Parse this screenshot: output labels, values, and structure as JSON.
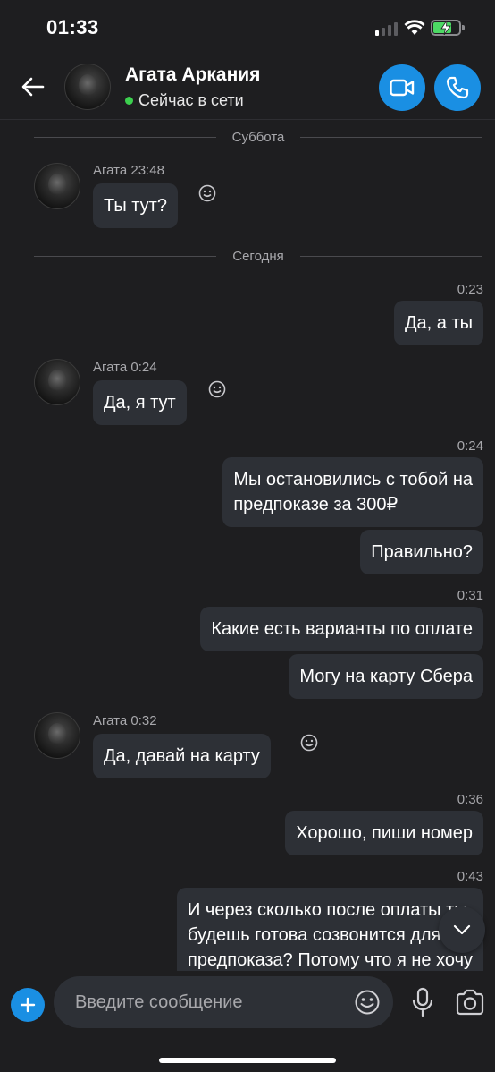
{
  "status_bar": {
    "time": "01:33"
  },
  "header": {
    "contact_name": "Агата Аркания",
    "status": "Сейчас в сети"
  },
  "chat": {
    "dividers": [
      "Суббота",
      "Сегодня"
    ],
    "messages": [
      {
        "sender": "Агата 23:48",
        "text": "Ты тут?"
      },
      {
        "time": "0:23",
        "text": "Да, а ты"
      },
      {
        "sender": "Агата 0:24",
        "text": "Да, я тут"
      },
      {
        "time": "0:24",
        "line1": "Мы остановились с тобой на",
        "line2": "предпоказе за 300₽"
      },
      {
        "text": "Правильно?"
      },
      {
        "time": "0:31",
        "text": "Какие есть варианты по оплате"
      },
      {
        "text": "Могу на карту Сбера"
      },
      {
        "sender": "Агата 0:32",
        "text": "Да, давай на карту"
      },
      {
        "time": "0:36",
        "text": "Хорошо, пиши номер"
      },
      {
        "time": "0:43",
        "line1": "И через сколько после оплаты ты",
        "line2": "будешь готова созвонится для",
        "line3": "предпоказа? Потому что я не хочу"
      }
    ]
  },
  "input": {
    "placeholder": "Введите сообщение"
  },
  "icons": {
    "back": "arrow-left-icon",
    "video": "video-camera-icon",
    "call": "phone-icon",
    "reaction": "smile-icon",
    "scroll": "chevron-down-icon",
    "add": "plus-icon",
    "emoji": "emoji-icon",
    "mic": "microphone-icon",
    "camera": "camera-icon"
  },
  "colors": {
    "background": "#1e1e20",
    "bubble": "#2d3036",
    "accent": "#1a8fe3",
    "online": "#3ccf4e"
  }
}
